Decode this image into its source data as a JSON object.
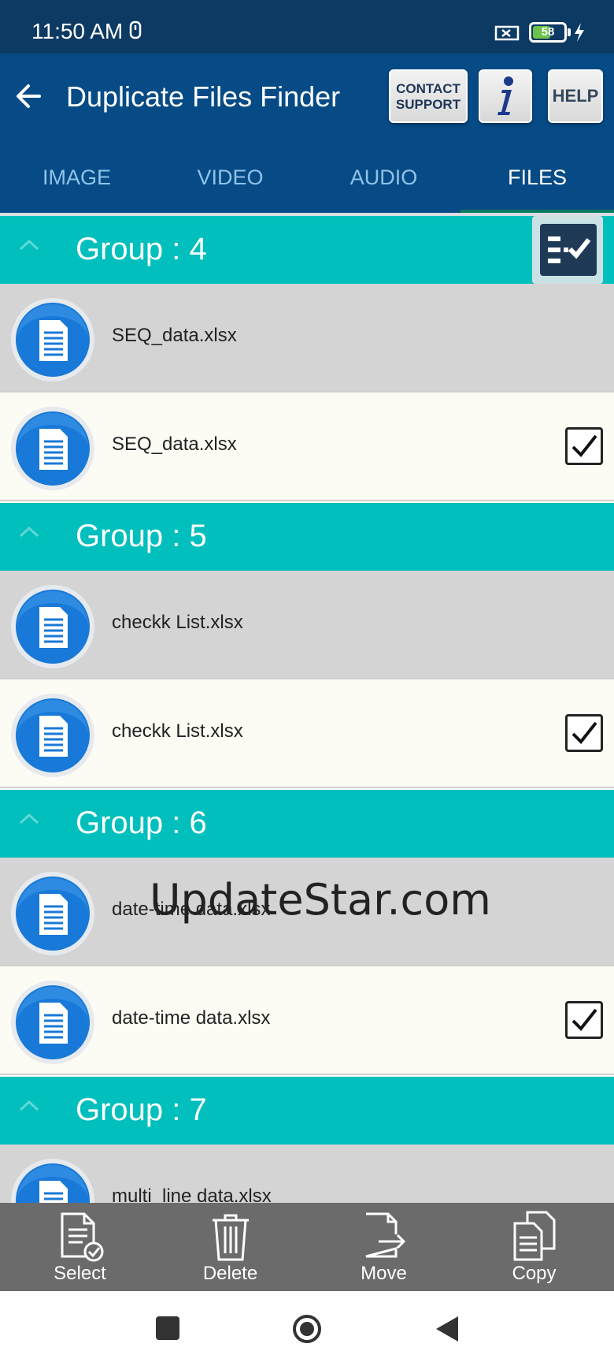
{
  "status_bar": {
    "time": "11:50 AM",
    "battery": "58",
    "battery_level": 0.58
  },
  "app_bar": {
    "title": "Duplicate Files Finder",
    "contact_label_line1": "CONTACT",
    "contact_label_line2": "SUPPORT",
    "info_label": "i",
    "help_label": "HELP"
  },
  "tabs": [
    {
      "label": "IMAGE",
      "active": false
    },
    {
      "label": "VIDEO",
      "active": false
    },
    {
      "label": "AUDIO",
      "active": false
    },
    {
      "label": "FILES",
      "active": true
    }
  ],
  "groups": [
    {
      "title": "Group : 4",
      "files": [
        {
          "name": "SEQ_data.xlsx",
          "checked": false
        },
        {
          "name": "SEQ_data.xlsx",
          "checked": true
        }
      ]
    },
    {
      "title": "Group : 5",
      "files": [
        {
          "name": "checkk List.xlsx",
          "checked": false
        },
        {
          "name": "checkk List.xlsx",
          "checked": true
        }
      ]
    },
    {
      "title": "Group : 6",
      "files": [
        {
          "name": "date-time data.xlsx",
          "checked": false
        },
        {
          "name": "date-time data.xlsx",
          "checked": true
        }
      ]
    },
    {
      "title": "Group : 7",
      "files": [
        {
          "name": "multi_line data.xlsx",
          "checked": false
        }
      ]
    }
  ],
  "watermark": "UpdateStar.com",
  "actions": [
    {
      "label": "Select",
      "icon": "select-doc-icon"
    },
    {
      "label": "Delete",
      "icon": "trash-icon"
    },
    {
      "label": "Move",
      "icon": "move-doc-icon"
    },
    {
      "label": "Copy",
      "icon": "copy-doc-icon"
    }
  ],
  "colors": {
    "status_bar": "#0d3a63",
    "app_bar": "#074b86",
    "group_header": "#00bfbc",
    "row_original": "#d4d4d4",
    "row_duplicate": "#fcfbf4",
    "action_bar": "#6b6b6b"
  }
}
